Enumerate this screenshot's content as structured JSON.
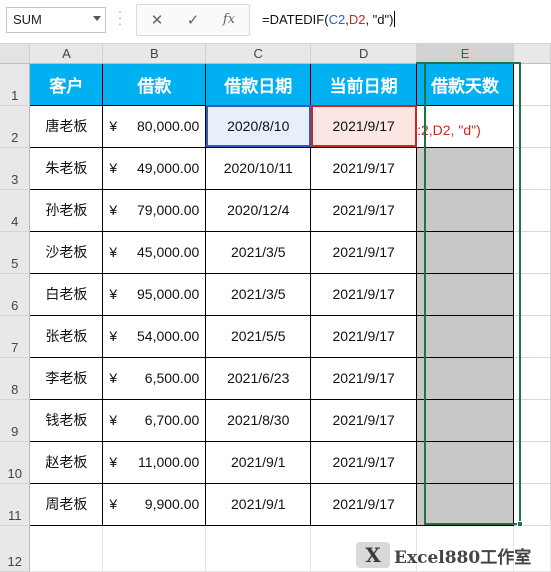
{
  "name_box": "SUM",
  "formula_bar": {
    "prefix": "=DATEDIF(",
    "ref1": "C2",
    "sep1": ",",
    "ref2": "D2",
    "suffix": ", \"d\")",
    "cancel_icon": "x-icon",
    "enter_icon": "check-icon",
    "fx_label": "fx"
  },
  "columns": [
    "A",
    "B",
    "C",
    "D",
    "E"
  ],
  "rows": [
    "1",
    "2",
    "3",
    "4",
    "5",
    "6",
    "7",
    "8",
    "9",
    "10",
    "11",
    "12"
  ],
  "headers": [
    "客户",
    "借款",
    "借款日期",
    "当前日期",
    "借款天数"
  ],
  "currency_symbol": "¥",
  "data": [
    {
      "customer": "唐老板",
      "amount": "80,000.00",
      "loan_date": "2020/8/10",
      "current_date": "2021/9/17"
    },
    {
      "customer": "朱老板",
      "amount": "49,000.00",
      "loan_date": "2020/10/11",
      "current_date": "2021/9/17"
    },
    {
      "customer": "孙老板",
      "amount": "79,000.00",
      "loan_date": "2020/12/4",
      "current_date": "2021/9/17"
    },
    {
      "customer": "沙老板",
      "amount": "45,000.00",
      "loan_date": "2021/3/5",
      "current_date": "2021/9/17"
    },
    {
      "customer": "白老板",
      "amount": "95,000.00",
      "loan_date": "2021/3/5",
      "current_date": "2021/9/17"
    },
    {
      "customer": "张老板",
      "amount": "54,000.00",
      "loan_date": "2021/5/5",
      "current_date": "2021/9/17"
    },
    {
      "customer": "李老板",
      "amount": "6,500.00",
      "loan_date": "2021/6/23",
      "current_date": "2021/9/17"
    },
    {
      "customer": "钱老板",
      "amount": "6,700.00",
      "loan_date": "2021/8/30",
      "current_date": "2021/9/17"
    },
    {
      "customer": "赵老板",
      "amount": "11,000.00",
      "loan_date": "2021/9/1",
      "current_date": "2021/9/17"
    },
    {
      "customer": "周老板",
      "amount": "9,900.00",
      "loan_date": "2021/9/1",
      "current_date": "2021/9/17"
    }
  ],
  "editing_cell_text": ":2,D2, \"d\")",
  "watermark": {
    "logo": "X",
    "text": "Excel880工作室"
  },
  "colors": {
    "header_fill": "#00b0f0",
    "ref1": "#2f5dbf",
    "ref2": "#c8281e",
    "selection": "#217346"
  }
}
